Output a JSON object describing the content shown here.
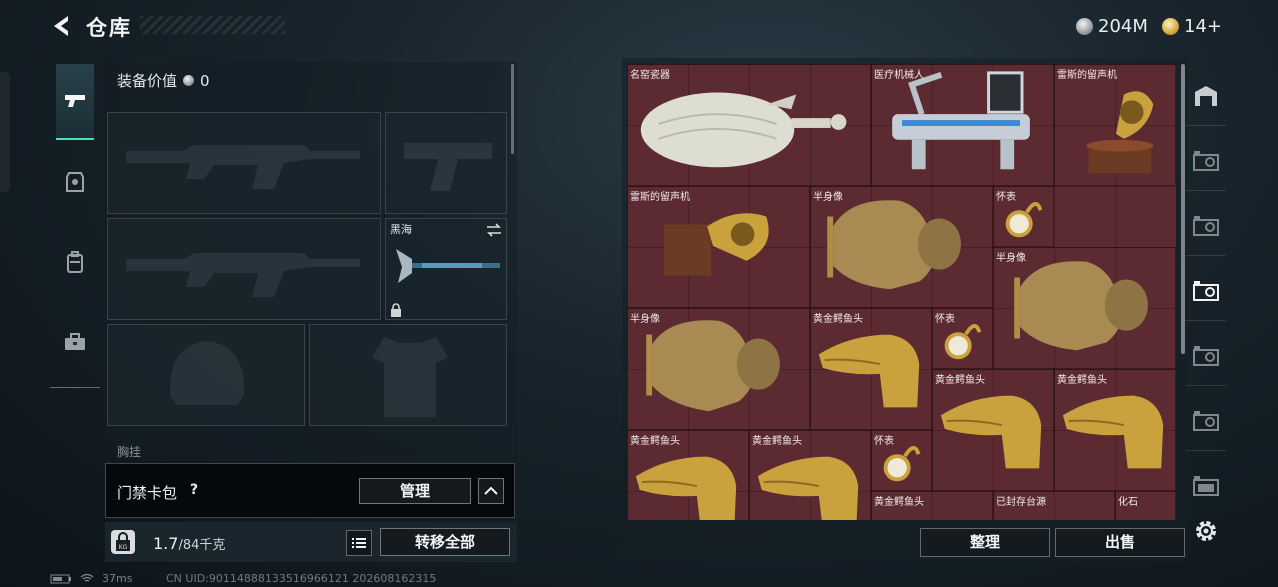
{
  "header": {
    "title": "仓库",
    "currency_silver": "204M",
    "currency_gold": "14+"
  },
  "equipment": {
    "value_label": "装备价值",
    "value": "0",
    "melee_slot_label": "黑海",
    "chest_label": "胸挂",
    "keycard": {
      "label": "门禁卡包",
      "help": "?",
      "manage_label": "管理"
    },
    "weight": {
      "current": "1.7",
      "capacity": "/84千克"
    },
    "transfer_all_label": "转移全部"
  },
  "status": {
    "ping": "37ms",
    "uid": "CN UID:90114888133516966121 202608162315"
  },
  "stash": {
    "items": [
      {
        "label": "名窑瓷器"
      },
      {
        "label": "医疗机械人"
      },
      {
        "label": "雷斯的留声机"
      },
      {
        "label": "雷斯的留声机"
      },
      {
        "label": "半身像"
      },
      {
        "label": "怀表"
      },
      {
        "label": "半身像"
      },
      {
        "label": "半身像"
      },
      {
        "label": "黄金鳄鱼头"
      },
      {
        "label": "怀表"
      },
      {
        "label": "黄金鳄鱼头"
      },
      {
        "label": "黄金鳄鱼头"
      },
      {
        "label": "黄金鳄鱼头"
      },
      {
        "label": "黄金鳄鱼头"
      },
      {
        "label": "怀表"
      },
      {
        "label": "黄金鳄鱼头"
      },
      {
        "label": "已封存台源"
      },
      {
        "label": "化石"
      }
    ],
    "organize_label": "整理",
    "sell_label": "出售"
  },
  "colors": {
    "accent": "#4ee0a5",
    "stash_bg": "#5c2a31",
    "gold": "#c9a23e"
  }
}
